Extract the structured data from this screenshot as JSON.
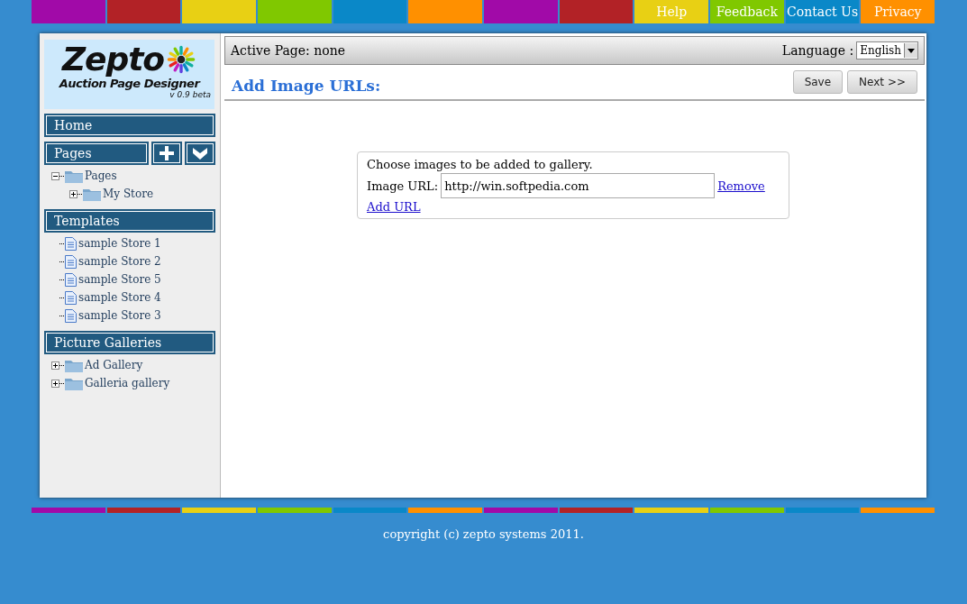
{
  "top_nav": [
    {
      "color": "#a10aa8"
    },
    {
      "color": "#b22226"
    },
    {
      "color": "#e8d014"
    },
    {
      "color": "#80c800"
    },
    {
      "color": "#0a88c8"
    },
    {
      "color": "#ff9000"
    },
    {
      "color": "#a10aa8"
    },
    {
      "color": "#b22226"
    },
    {
      "label": "Help",
      "color": "#e8d014"
    },
    {
      "label": "Feedback",
      "color": "#80c800"
    },
    {
      "label": "Contact Us",
      "color": "#0a88c8"
    },
    {
      "label": "Privacy",
      "color": "#ff9000"
    }
  ],
  "logo": {
    "title": "Zepto",
    "subtitle": "Auction Page Designer",
    "version": "v 0.9 beta"
  },
  "sidebar": {
    "sections": [
      {
        "title": "Home",
        "kind": "link"
      },
      {
        "title": "Pages",
        "kind": "tree_actions",
        "items": [
          {
            "label": "Pages",
            "kind": "folder",
            "expanded": true,
            "children": [
              {
                "label": "My Store",
                "kind": "folder",
                "expanded": false
              }
            ]
          }
        ]
      },
      {
        "title": "Templates",
        "kind": "tree",
        "items": [
          {
            "label": "sample Store 1",
            "kind": "document"
          },
          {
            "label": "sample Store 2",
            "kind": "document"
          },
          {
            "label": "sample Store 5",
            "kind": "document"
          },
          {
            "label": "sample Store 4",
            "kind": "document"
          },
          {
            "label": "sample Store 3",
            "kind": "document"
          }
        ]
      },
      {
        "title": "Picture Galleries",
        "kind": "tree",
        "items": [
          {
            "label": "Ad Gallery",
            "kind": "folder",
            "expanded": false
          },
          {
            "label": "Galleria gallery",
            "kind": "folder",
            "expanded": false
          }
        ]
      }
    ]
  },
  "header": {
    "active_page": "Active Page: none",
    "language_label": "Language :",
    "language": "English"
  },
  "title": "Add Image URLs:",
  "buttons": [
    "Save",
    "Next >>"
  ],
  "form": {
    "intro": "Choose images to be added to gallery.",
    "field_label": "Image URL:",
    "value": "http://win.softpedia.com",
    "remove_link": "Remove",
    "add_link": "Add URL"
  },
  "footer_strip": [
    {
      "color": "#a10aa8"
    },
    {
      "color": "#b22226"
    },
    {
      "color": "#e8d014"
    },
    {
      "color": "#80c800"
    },
    {
      "color": "#0a88c8"
    },
    {
      "color": "#ff9000"
    },
    {
      "color": "#a10aa8"
    },
    {
      "color": "#b22226"
    },
    {
      "color": "#e8d014"
    },
    {
      "color": "#80c800"
    },
    {
      "color": "#0a88c8"
    },
    {
      "color": "#ff9000"
    }
  ],
  "copyright": "copyright (c) zepto systems 2011."
}
